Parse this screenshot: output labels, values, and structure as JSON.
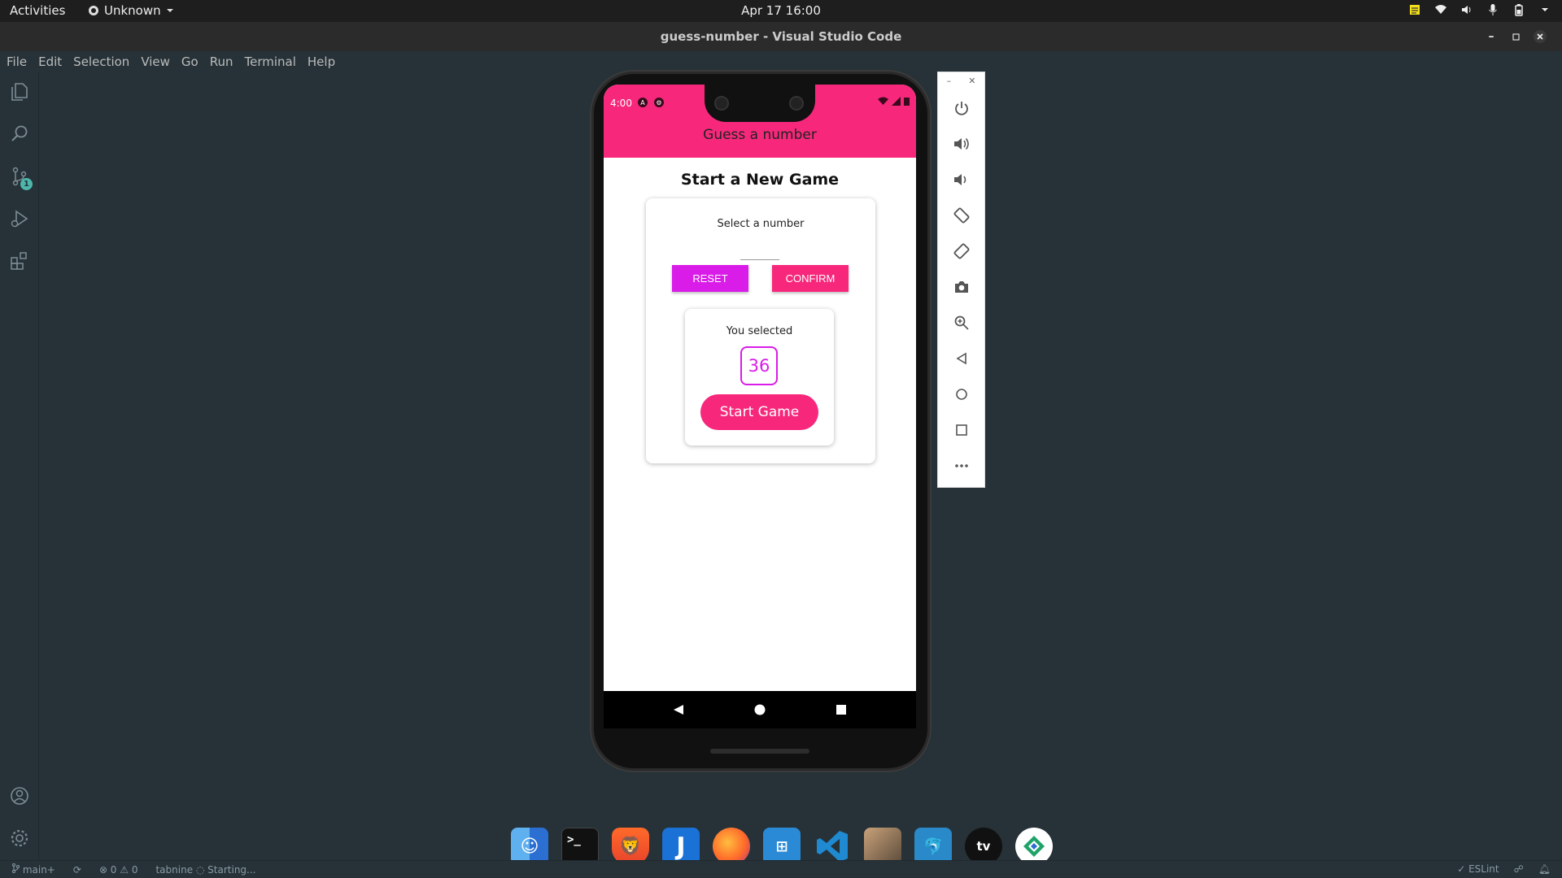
{
  "topbar": {
    "activities": "Activities",
    "app_menu": "Unknown",
    "clock": "Apr 17  16:00"
  },
  "window": {
    "title": "guess-number - Visual Studio Code"
  },
  "menubar": {
    "items": [
      "File",
      "Edit",
      "Selection",
      "View",
      "Go",
      "Run",
      "Terminal",
      "Help"
    ]
  },
  "activitybar": {
    "source_control_badge": "1",
    "items": [
      "files-icon",
      "search-icon",
      "source-control-icon",
      "run-debug-icon",
      "extensions-icon",
      "account-icon",
      "gear-icon"
    ]
  },
  "statusbar": {
    "branch": "main+",
    "problems": "⊗ 0 ⚠ 0",
    "tabnine": "tabnine ◌ Starting...",
    "eslint": "✓ ESLint"
  },
  "phone": {
    "status_time": "4:00",
    "app_title": "Guess a number",
    "game_title": "Start a New Game",
    "select_label": "Select a number",
    "input_value": "",
    "reset_label": "RESET",
    "confirm_label": "CONFIRM",
    "you_selected": "You selected",
    "selected_number": "36",
    "start_label": "Start Game"
  },
  "emulator_toolbar": {
    "items": [
      "power-icon",
      "volume-up-icon",
      "volume-down-icon",
      "rotate-left-icon",
      "rotate-right-icon",
      "camera-icon",
      "zoom-icon",
      "back-icon",
      "home-icon",
      "overview-icon",
      "more-icon"
    ]
  },
  "dock": {
    "apps": [
      "finder",
      "terminal",
      "brave",
      "joplin",
      "firefox",
      "multi-os",
      "vscode",
      "photos",
      "mysql-workbench",
      "apple-tv",
      "anydesk"
    ]
  },
  "colors": {
    "accent_pink": "#f7287b",
    "accent_magenta": "#d91ce8",
    "editor_bg": "#263238"
  }
}
